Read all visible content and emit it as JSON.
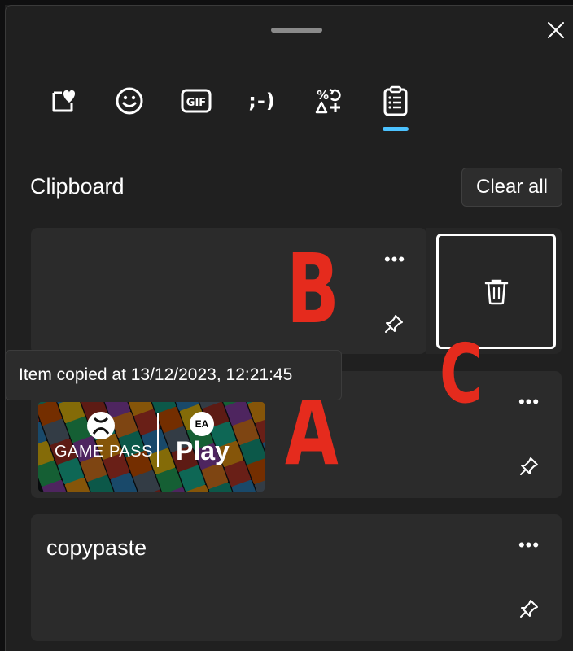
{
  "panel": {
    "close_label": "close",
    "section_title": "Clipboard",
    "clear_all_label": "Clear all"
  },
  "tabs": [
    {
      "name": "favorites",
      "icon": "heart-note-icon",
      "active": false
    },
    {
      "name": "emoji",
      "icon": "smiley-icon",
      "active": false
    },
    {
      "name": "gif",
      "icon": "gif-icon",
      "label": "GIF",
      "active": false
    },
    {
      "name": "kaomoji",
      "icon": "kaomoji-icon",
      "label": ";-)",
      "active": false
    },
    {
      "name": "symbols",
      "icon": "symbols-icon",
      "active": false
    },
    {
      "name": "clipboard",
      "icon": "clipboard-icon",
      "active": true
    }
  ],
  "tooltip": {
    "text": "Item copied at 13/12/2023, 12:21:45"
  },
  "items": [
    {
      "kind": "empty",
      "more_label": "•••"
    },
    {
      "kind": "image",
      "more_label": "•••",
      "image_text": {
        "left": "GAME PASS",
        "right": "Play",
        "ea": "EA"
      }
    },
    {
      "kind": "text",
      "text": "copypaste",
      "more_label": "•••"
    }
  ],
  "annotations": {
    "a": "A",
    "b": "B",
    "c": "C",
    "color": "#e52b1d"
  },
  "colors": {
    "accent": "#4cc2ff",
    "background": "#202020",
    "card": "#2b2b2b"
  }
}
